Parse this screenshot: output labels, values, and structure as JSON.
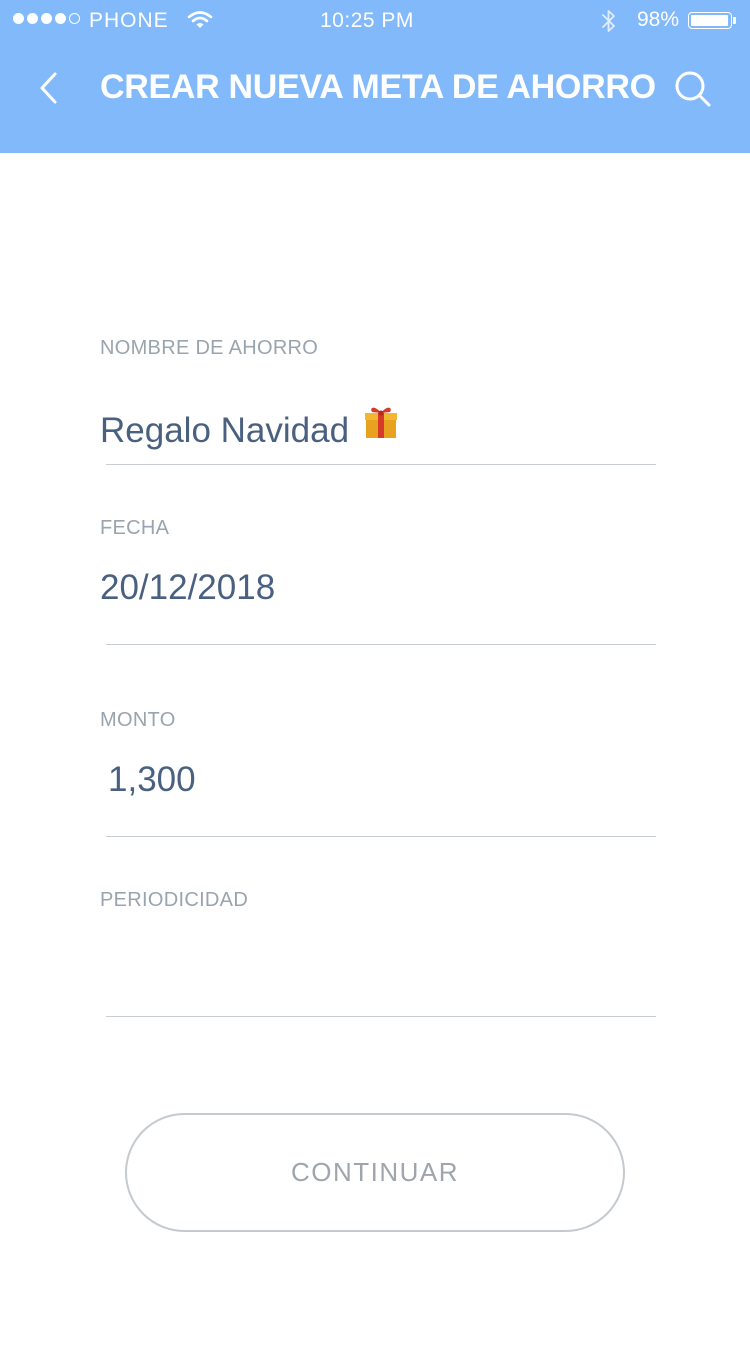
{
  "status_bar": {
    "carrier": "PHONE",
    "time": "10:25 PM",
    "battery_percent": "98%",
    "battery_level": 0.98,
    "signal_bars_filled": 4,
    "signal_bars_total": 5
  },
  "header": {
    "title": "CREAR NUEVA META DE AHORRO",
    "background_color": "#82b9fb",
    "back_icon": "chevron-left-icon",
    "search_icon": "search-icon"
  },
  "form": {
    "nombre": {
      "label": "NOMBRE DE AHORRO",
      "value": "Regalo Navidad",
      "icon": "gift-icon"
    },
    "fecha": {
      "label": "FECHA",
      "value": "20/12/2018"
    },
    "monto": {
      "label": "MONTO",
      "value": "1,300"
    },
    "periodicidad": {
      "label": "PERIODICIDAD",
      "value": ""
    }
  },
  "continue_button": {
    "label": "CONTINUAR"
  }
}
